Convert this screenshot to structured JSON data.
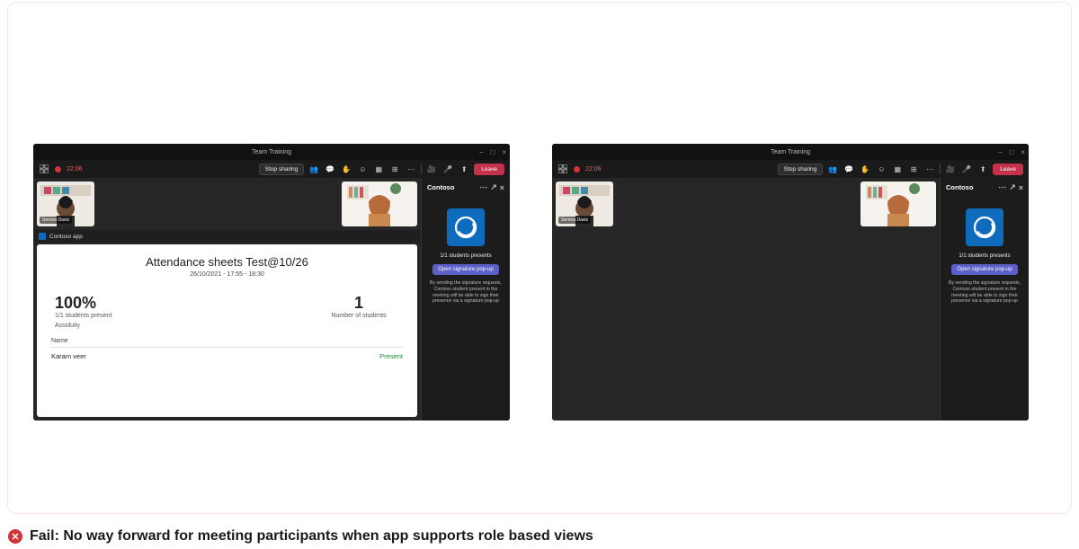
{
  "fail": {
    "text": "Fail: No way forward for meeting participants when app supports role based views"
  },
  "teams": {
    "title": "Team Training",
    "timer": "22:06",
    "stop_sharing": "Stop sharing",
    "leave": "Leave",
    "participant_name": "Serena Davis"
  },
  "panel": {
    "title": "Contoso",
    "count_line": "1/1 students presents",
    "button": "Open signature pop-up",
    "desc": "By sending the signature requests, Contoso student present in the meeting will be able to sign their presence via a signature pop-up"
  },
  "apptab": {
    "label": "Contoso app"
  },
  "card": {
    "title": "Attendance sheets Test@10/26",
    "subtitle": "26/10/2021 - 17:55 - 18:30",
    "pct": "100%",
    "pct_line1": "1/1 students present",
    "pct_line2": "Assiduity",
    "num": "1",
    "num_line": "Number of students",
    "th_name": "Name",
    "row_name": "Karam veer",
    "row_status": "Present"
  }
}
